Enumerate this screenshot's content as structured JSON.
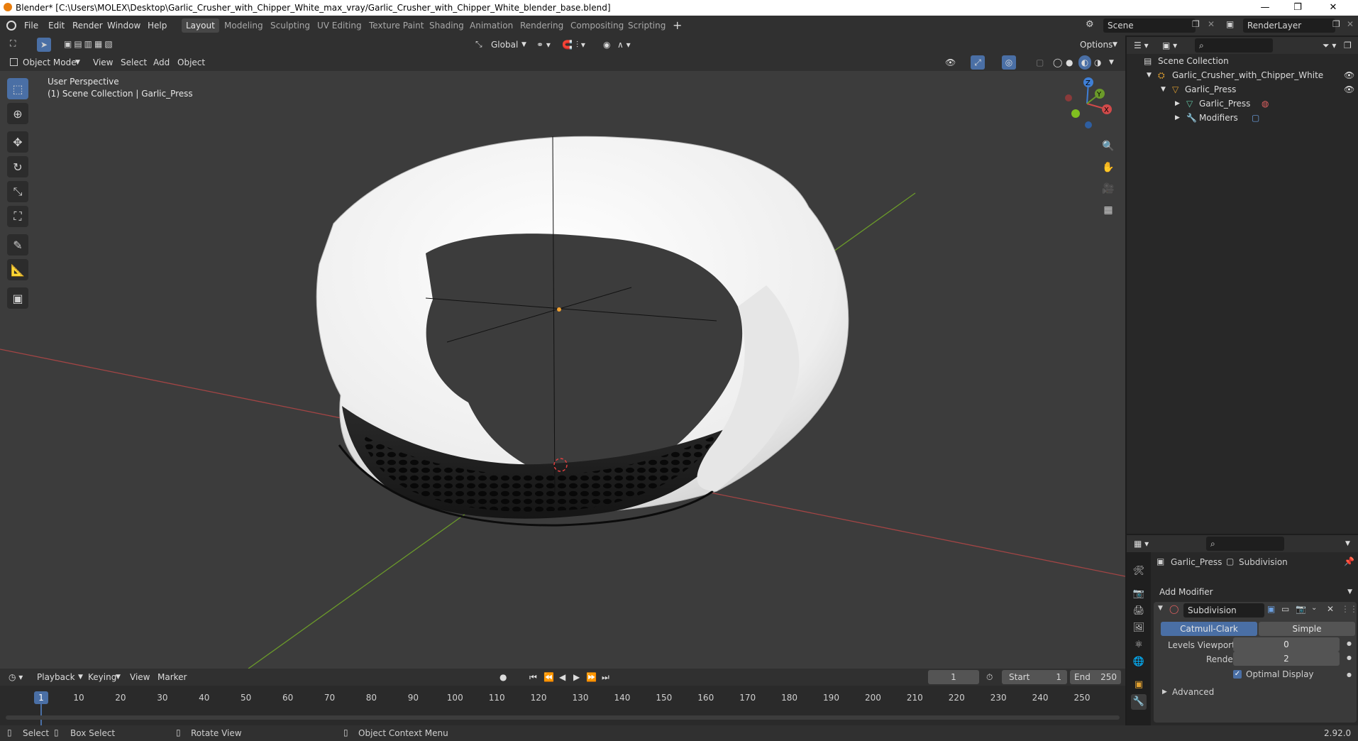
{
  "window": {
    "title": "Blender* [C:\\Users\\MOLEX\\Desktop\\Garlic_Crusher_with_Chipper_White_max_vray/Garlic_Crusher_with_Chipper_White_blender_base.blend]",
    "minimize": "—",
    "maximize": "❐",
    "close": "✕"
  },
  "menu": {
    "items": [
      "File",
      "Edit",
      "Render",
      "Window",
      "Help"
    ],
    "workspaces": [
      "Layout",
      "Modeling",
      "Sculpting",
      "UV Editing",
      "Texture Paint",
      "Shading",
      "Animation",
      "Rendering",
      "Compositing",
      "Scripting"
    ],
    "active_workspace": "Layout",
    "add_workspace": "+",
    "scene": "Scene",
    "render_layer": "RenderLayer"
  },
  "tool_header": {
    "transform_orientation": "Global",
    "options": "Options"
  },
  "viewport_header": {
    "mode": "Object Mode",
    "menus": [
      "View",
      "Select",
      "Add",
      "Object"
    ]
  },
  "viewport": {
    "perspective": "User Perspective",
    "collection_info": "(1) Scene Collection | Garlic_Press",
    "gizmo_axes": [
      "X",
      "Y",
      "Z"
    ]
  },
  "timeline": {
    "menus": [
      "Playback",
      "Keying",
      "View",
      "Marker"
    ],
    "current_frame": "1",
    "start_label": "Start",
    "start": "1",
    "end_label": "End",
    "end": "250",
    "ticks": [
      "1",
      "10",
      "20",
      "30",
      "40",
      "50",
      "60",
      "70",
      "80",
      "90",
      "100",
      "110",
      "120",
      "130",
      "140",
      "150",
      "160",
      "170",
      "180",
      "190",
      "200",
      "210",
      "220",
      "230",
      "240",
      "250"
    ]
  },
  "statusbar": {
    "select": "Select",
    "box_select": "Box Select",
    "rotate_view": "Rotate View",
    "context_menu": "Object Context Menu",
    "version": "2.92.0"
  },
  "outliner": {
    "scene_collection": "Scene Collection",
    "items": [
      {
        "label": "Garlic_Crusher_with_Chipper_White",
        "depth": 1
      },
      {
        "label": "Garlic_Press",
        "depth": 2
      },
      {
        "label": "Garlic_Press",
        "depth": 3
      },
      {
        "label": "Modifiers",
        "depth": 3
      }
    ]
  },
  "properties": {
    "object_name": "Garlic_Press",
    "modifier_tab": "Subdivision",
    "add_modifier": "Add Modifier",
    "modifier_name": "Subdivision",
    "type_catmull": "Catmull-Clark",
    "type_simple": "Simple",
    "levels_viewport_label": "Levels Viewport",
    "levels_viewport": "0",
    "render_label": "Render",
    "render": "2",
    "optimal_display": "Optimal Display",
    "advanced": "Advanced"
  },
  "colors": {
    "accent": "#4a6fa5",
    "x_axis": "#b14a4a",
    "y_axis": "#6b9a2a",
    "z_axis": "#3f7fd6",
    "viewport_bg": "#3c3c3c"
  }
}
